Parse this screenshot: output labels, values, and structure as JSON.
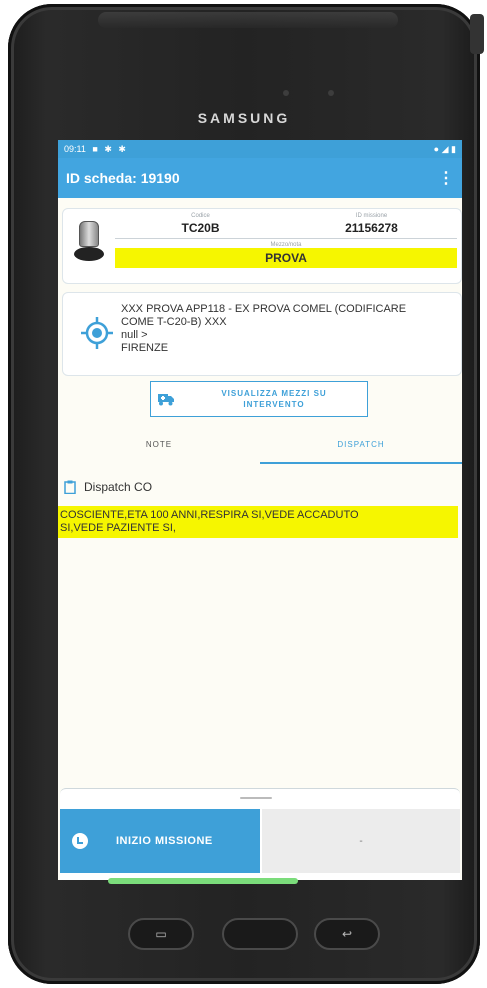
{
  "device": {
    "brand": "SAMSUNG"
  },
  "statusbar": {
    "time": "09:11",
    "left_icons": [
      "notification-icon",
      "bug-icon",
      "bug-icon"
    ],
    "right_icons": [
      "location-icon",
      "wifi-icon",
      "battery-icon"
    ]
  },
  "appbar": {
    "title": "ID scheda: 19190",
    "menu_icon": "more-vert-icon"
  },
  "vehicle_card": {
    "codice_label": "Codice",
    "codice_value": "TC20B",
    "missione_label": "ID missione",
    "missione_value": "21156278",
    "mezzo_label": "Mezzo/nota",
    "mezzo_value": "PROVA"
  },
  "location_card": {
    "line1": "XXX PROVA APP118 - EX PROVA COMEL (CODIFICARE",
    "line2": "COME T-C20-B) XXX",
    "line3": "null >",
    "line4": "FIRENZE"
  },
  "mezzi_button": {
    "line1": "VISUALIZZA MEZZI SU",
    "line2": "INTERVENTO"
  },
  "tabs": [
    {
      "label": "NOTE",
      "active": false
    },
    {
      "label": "DISPATCH",
      "active": true
    }
  ],
  "dispatch": {
    "title": "Dispatch CO",
    "text_line1": "COSCIENTE,ETA 100 ANNI,RESPIRA SI,VEDE ACCADUTO",
    "text_line2": "SI,VEDE PAZIENTE SI,"
  },
  "bottom_sheet": {
    "start_label": "INIZIO MISSIONE",
    "side_value": "-"
  },
  "colors": {
    "primary": "#3ea0d8",
    "highlight": "#f6f600"
  }
}
